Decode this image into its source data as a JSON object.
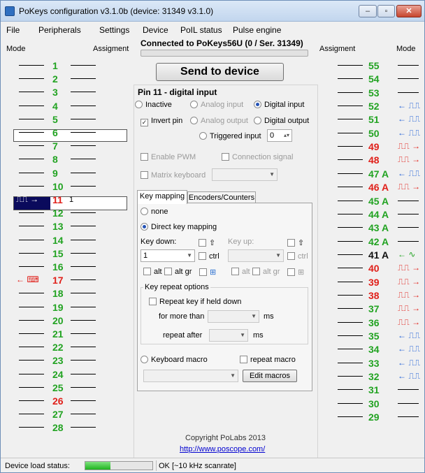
{
  "window": {
    "title": "PoKeys configuration v3.1.0b (device: 31349 v3.1.0)",
    "min_glyph": "–",
    "max_glyph": "▫",
    "close_glyph": "✕"
  },
  "menu": [
    "File",
    "Peripherals",
    "Settings",
    "Device",
    "PoIL status",
    "Pulse engine"
  ],
  "headers": {
    "left_mode": "Mode",
    "left_assignment": "Assigment",
    "right_assignment": "Assigment",
    "right_mode": "Mode"
  },
  "connection": "Connected to PoKeys56U (0 / Ser. 31349)",
  "send_button": "Send to device",
  "left_pins": [
    {
      "num": "1",
      "color": "green",
      "mode": "",
      "mode_color": "",
      "assign": ""
    },
    {
      "num": "2",
      "color": "green",
      "mode": "",
      "mode_color": "",
      "assign": ""
    },
    {
      "num": "3",
      "color": "green",
      "mode": "",
      "mode_color": "",
      "assign": ""
    },
    {
      "num": "4",
      "color": "green",
      "mode": "",
      "mode_color": "",
      "assign": ""
    },
    {
      "num": "5",
      "color": "green",
      "mode": "",
      "mode_color": "",
      "assign": ""
    },
    {
      "num": "6",
      "color": "green",
      "mode": "",
      "mode_color": "",
      "assign": ""
    },
    {
      "num": "7",
      "color": "green",
      "mode": "",
      "mode_color": "",
      "assign": ""
    },
    {
      "num": "8",
      "color": "green",
      "mode": "",
      "mode_color": "",
      "assign": ""
    },
    {
      "num": "9",
      "color": "green",
      "mode": "",
      "mode_color": "",
      "assign": ""
    },
    {
      "num": "10",
      "color": "green",
      "mode": "",
      "mode_color": "",
      "assign": ""
    },
    {
      "num": "11",
      "color": "red",
      "mode": "⎍⎍ →",
      "mode_color": "white",
      "assign": "1"
    },
    {
      "num": "12",
      "color": "green",
      "mode": "",
      "mode_color": "",
      "assign": ""
    },
    {
      "num": "13",
      "color": "green",
      "mode": "",
      "mode_color": "",
      "assign": ""
    },
    {
      "num": "14",
      "color": "green",
      "mode": "",
      "mode_color": "",
      "assign": ""
    },
    {
      "num": "15",
      "color": "green",
      "mode": "",
      "mode_color": "",
      "assign": ""
    },
    {
      "num": "16",
      "color": "green",
      "mode": "",
      "mode_color": "",
      "assign": ""
    },
    {
      "num": "17",
      "color": "red",
      "mode": "← ⌨",
      "mode_color": "red",
      "assign": ""
    },
    {
      "num": "18",
      "color": "green",
      "mode": "",
      "mode_color": "",
      "assign": ""
    },
    {
      "num": "19",
      "color": "green",
      "mode": "",
      "mode_color": "",
      "assign": ""
    },
    {
      "num": "20",
      "color": "green",
      "mode": "",
      "mode_color": "",
      "assign": ""
    },
    {
      "num": "21",
      "color": "green",
      "mode": "",
      "mode_color": "",
      "assign": ""
    },
    {
      "num": "22",
      "color": "green",
      "mode": "",
      "mode_color": "",
      "assign": ""
    },
    {
      "num": "23",
      "color": "green",
      "mode": "",
      "mode_color": "",
      "assign": ""
    },
    {
      "num": "24",
      "color": "green",
      "mode": "",
      "mode_color": "",
      "assign": ""
    },
    {
      "num": "25",
      "color": "green",
      "mode": "",
      "mode_color": "",
      "assign": ""
    },
    {
      "num": "26",
      "color": "red",
      "mode": "",
      "mode_color": "",
      "assign": ""
    },
    {
      "num": "27",
      "color": "green",
      "mode": "",
      "mode_color": "",
      "assign": ""
    },
    {
      "num": "28",
      "color": "green",
      "mode": "",
      "mode_color": "",
      "assign": ""
    }
  ],
  "right_pins": [
    {
      "num": "55",
      "color": "green",
      "mode": "",
      "mode_color": ""
    },
    {
      "num": "54",
      "color": "green",
      "mode": "",
      "mode_color": ""
    },
    {
      "num": "53",
      "color": "green",
      "mode": "",
      "mode_color": ""
    },
    {
      "num": "52",
      "color": "green",
      "mode": "← ⎍⎍",
      "mode_color": "blue"
    },
    {
      "num": "51",
      "color": "green",
      "mode": "← ⎍⎍",
      "mode_color": "blue"
    },
    {
      "num": "50",
      "color": "green",
      "mode": "← ⎍⎍",
      "mode_color": "blue"
    },
    {
      "num": "49",
      "color": "red",
      "mode": "⎍⎍ →",
      "mode_color": "red"
    },
    {
      "num": "48",
      "color": "red",
      "mode": "⎍⎍ →",
      "mode_color": "red"
    },
    {
      "num": "47 A",
      "color": "green",
      "mode": "← ⎍⎍",
      "mode_color": "blue"
    },
    {
      "num": "46 A",
      "color": "red",
      "mode": "⎍⎍ →",
      "mode_color": "red"
    },
    {
      "num": "45 A",
      "color": "green",
      "mode": "",
      "mode_color": ""
    },
    {
      "num": "44 A",
      "color": "green",
      "mode": "",
      "mode_color": ""
    },
    {
      "num": "43 A",
      "color": "green",
      "mode": "",
      "mode_color": ""
    },
    {
      "num": "42 A",
      "color": "green",
      "mode": "",
      "mode_color": ""
    },
    {
      "num": "41 A",
      "color": "dark",
      "mode": "← ∿",
      "mode_color": "green"
    },
    {
      "num": "40",
      "color": "red",
      "mode": "⎍⎍ →",
      "mode_color": "red"
    },
    {
      "num": "39",
      "color": "red",
      "mode": "⎍⎍ →",
      "mode_color": "red"
    },
    {
      "num": "38",
      "color": "red",
      "mode": "⎍⎍ →",
      "mode_color": "red"
    },
    {
      "num": "37",
      "color": "green",
      "mode": "⎍⎍ →",
      "mode_color": "red"
    },
    {
      "num": "36",
      "color": "green",
      "mode": "⎍⎍ →",
      "mode_color": "red"
    },
    {
      "num": "35",
      "color": "green",
      "mode": "← ⎍⎍",
      "mode_color": "blue"
    },
    {
      "num": "34",
      "color": "green",
      "mode": "← ⎍⎍",
      "mode_color": "blue"
    },
    {
      "num": "33",
      "color": "green",
      "mode": "← ⎍⎍",
      "mode_color": "blue"
    },
    {
      "num": "32",
      "color": "green",
      "mode": "← ⎍⎍",
      "mode_color": "blue"
    },
    {
      "num": "31",
      "color": "green",
      "mode": "",
      "mode_color": ""
    },
    {
      "num": "30",
      "color": "green",
      "mode": "",
      "mode_color": ""
    },
    {
      "num": "29",
      "color": "green",
      "mode": "",
      "mode_color": ""
    }
  ],
  "pin_panel": {
    "title": "Pin 11 - digital input",
    "inactive": "Inactive",
    "analog_input": "Analog input",
    "digital_input": "Digital input",
    "invert_pin": "Invert pin",
    "analog_output": "Analog output",
    "digital_output": "Digital output",
    "triggered_input": "Triggered input",
    "triggered_value": "0",
    "enable_pwm": "Enable PWM",
    "connection_signal": "Connection signal",
    "matrix_keyboard": "Matrix keyboard",
    "check_mark": "✓",
    "dropdown_glyph": "▼",
    "spin_glyph": "▴▾"
  },
  "tabs": {
    "key_mapping": "Key mapping",
    "encoders": "Encoders/Counters"
  },
  "key_mapping": {
    "none": "none",
    "direct": "Direct key mapping",
    "key_down": "Key down:",
    "key_up": "Key up:",
    "key_down_value": "1",
    "shift_glyph": "⇧",
    "ctrl": "ctrl",
    "alt": "alt",
    "alt_gr": "alt gr",
    "win_glyph": "⊞"
  },
  "repeat": {
    "group": "Key repeat options",
    "repeat_if_held": "Repeat key if held down",
    "for_more_than": "for more than",
    "repeat_after": "repeat after",
    "ms": "ms"
  },
  "macro": {
    "keyboard_macro": "Keyboard macro",
    "repeat_macro": "repeat macro",
    "edit_macros": "Edit macros"
  },
  "footer": {
    "copyright": "Copyright PoLabs 2013",
    "link": "http://www.poscope.com/"
  },
  "status": {
    "label": "Device load status:",
    "load_fraction": 0.38,
    "text": "OK [~10 kHz scanrate]"
  }
}
